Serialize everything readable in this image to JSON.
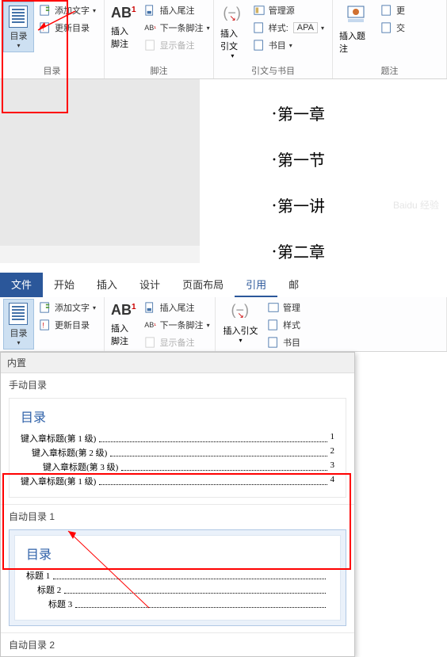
{
  "ribbon_top": {
    "toc": {
      "label": "目录"
    },
    "add_text": "添加文字",
    "update_toc": "更新目录",
    "group1_label": "目录",
    "insert_footnote_big": "插入脚注",
    "ab_sup": "1",
    "insert_endnote": "插入尾注",
    "next_footnote": "下一条脚注",
    "show_notes": "显示备注",
    "group2_label": "脚注",
    "insert_citation": "插入引文",
    "manage_sources": "管理源",
    "style_label": "样式:",
    "style_value": "APA",
    "bibliography": "书目",
    "group3_label": "引文与书目",
    "insert_caption": "插入题注",
    "update": "更",
    "cross_ref": "交",
    "group4_label": "题注"
  },
  "doc": {
    "h1": "第一章",
    "h2": "第一节",
    "h3": "第一讲",
    "h4": "第二章"
  },
  "tabs2": {
    "file": "文件",
    "home": "开始",
    "insert": "插入",
    "design": "设计",
    "layout": "页面布局",
    "references": "引用",
    "mail": "邮"
  },
  "ribbon2": {
    "toc": "目录",
    "add_text": "添加文字",
    "update_toc": "更新目录",
    "insert_footnote_big": "插入脚注",
    "ab_sup": "1",
    "insert_endnote": "插入尾注",
    "next_footnote": "下一条脚注",
    "show_notes": "显示备注",
    "insert_citation": "插入引文",
    "manage": "管理",
    "style": "样式",
    "biblio": "书目"
  },
  "dropdown": {
    "builtin": "内置",
    "manual_toc": "手动目录",
    "auto_toc_1": "自动目录 1",
    "auto_toc_2": "自动目录 2",
    "toc_title": "目录",
    "manual_lines": [
      {
        "text": "键入章标题(第 1 级)",
        "page": "1"
      },
      {
        "text": "键入章标题(第 2 级)",
        "page": "2"
      },
      {
        "text": "键入章标题(第 3 级)",
        "page": "3"
      },
      {
        "text": "键入章标题(第 1 级)",
        "page": "4"
      }
    ],
    "auto_lines": [
      {
        "text": "标题 1",
        "page": ""
      },
      {
        "text": "标题 2",
        "page": ""
      },
      {
        "text": "标题 3",
        "page": ""
      }
    ]
  }
}
